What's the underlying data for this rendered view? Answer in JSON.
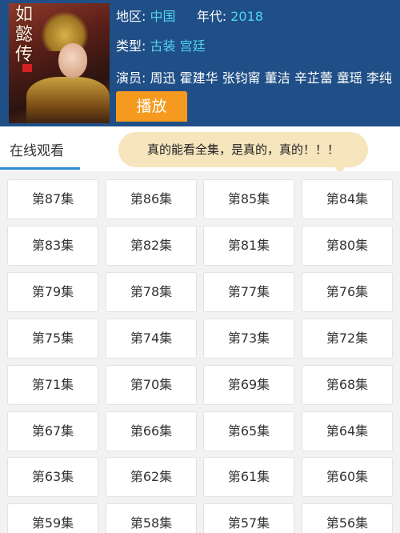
{
  "poster": {
    "title_chars": [
      "如",
      "懿",
      "传"
    ]
  },
  "info": {
    "region_label": "地区:",
    "region_value": "中国",
    "year_label": "年代:",
    "year_value": "2018",
    "type_label": "类型:",
    "type_values": [
      "古装",
      "宫廷"
    ],
    "cast_label": "演员:",
    "cast": "周迅 霍建华 张钧甯 董洁 辛芷蕾 童瑶 李纯"
  },
  "play_button": "播放",
  "tabs": {
    "online": "在线观看"
  },
  "bubble": "真的能看全集，是真的，真的！！！",
  "episodes": [
    "第87集",
    "第86集",
    "第85集",
    "第84集",
    "第83集",
    "第82集",
    "第81集",
    "第80集",
    "第79集",
    "第78集",
    "第77集",
    "第76集",
    "第75集",
    "第74集",
    "第73集",
    "第72集",
    "第71集",
    "第70集",
    "第69集",
    "第68集",
    "第67集",
    "第66集",
    "第65集",
    "第64集",
    "第63集",
    "第62集",
    "第61集",
    "第60集",
    "第59集",
    "第58集",
    "第57集",
    "第56集"
  ],
  "colors": {
    "header_bg": "#1f4f86",
    "value_text": "#52d3f0",
    "play_button": "#f59a1f",
    "tab_underline": "#2c8fd6",
    "bubble_bg": "#f6e5bd"
  }
}
